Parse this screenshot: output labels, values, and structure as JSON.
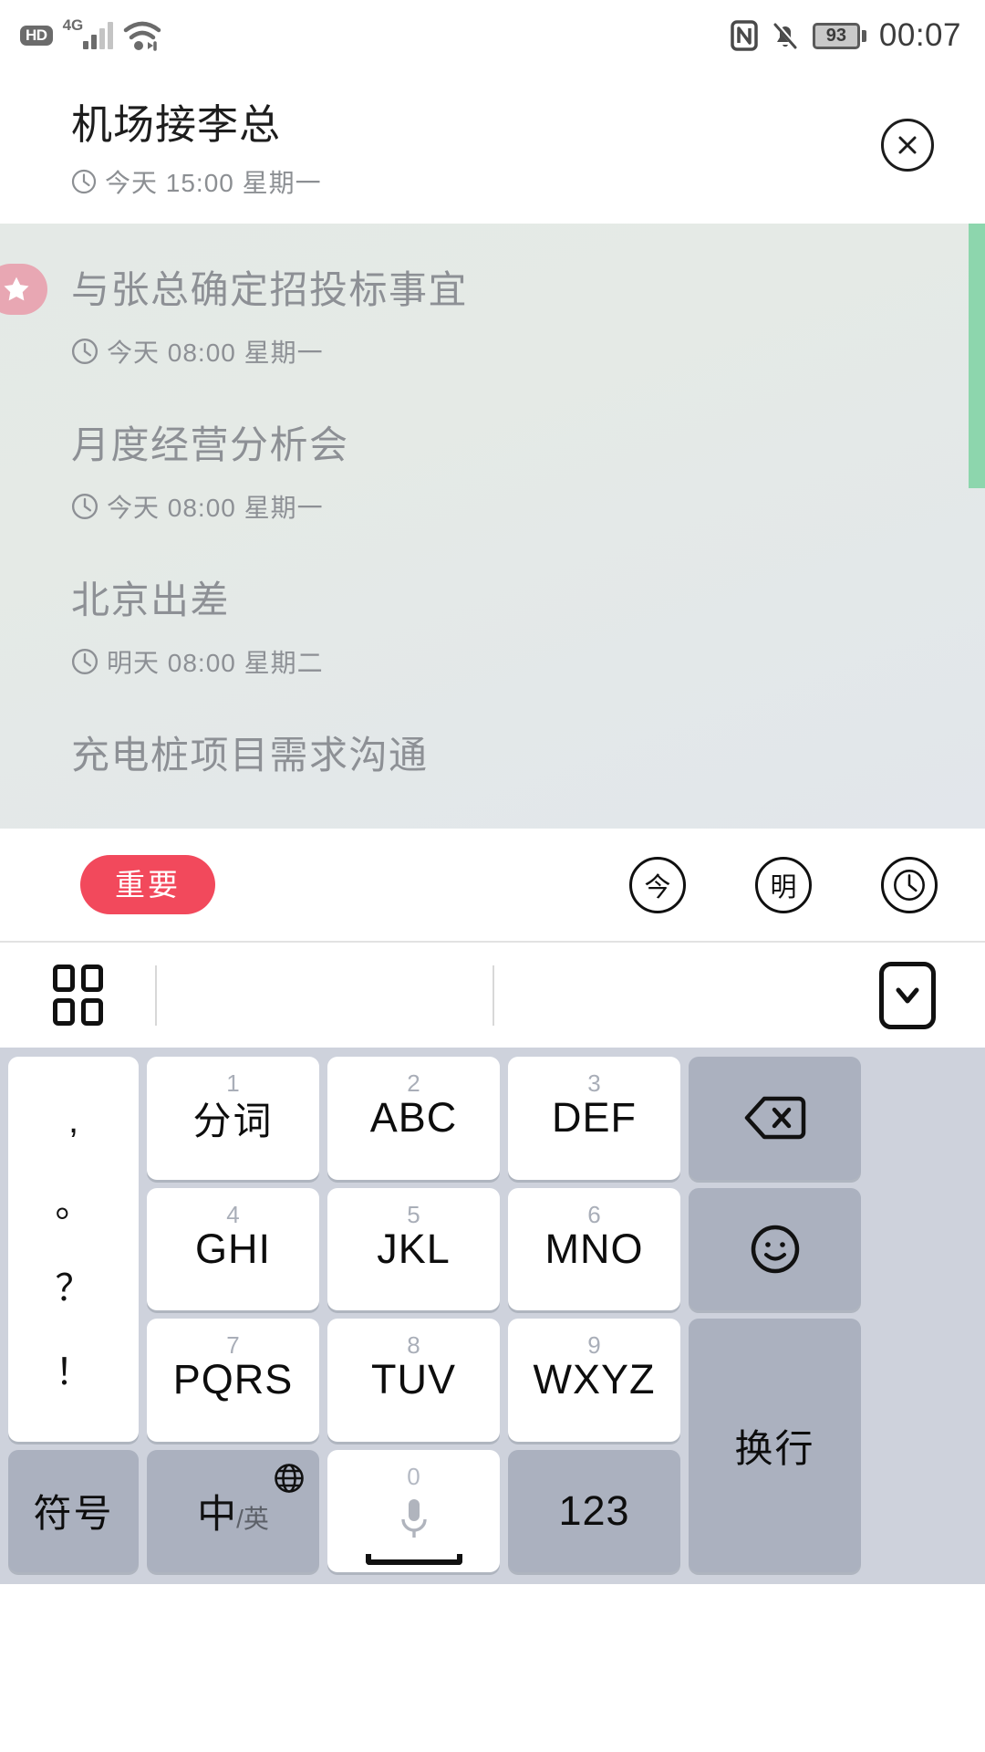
{
  "statusbar": {
    "hd_label": "HD",
    "network_label": "4G",
    "signal_icon": "signal-bars-icon",
    "wifi_icon": "wifi-icon",
    "nfc_icon": "nfc-icon",
    "mute_icon": "bell-muted-icon",
    "battery_level": "93",
    "time": "00:07"
  },
  "header": {
    "title": "机场接李总",
    "clock_icon": "clock-icon",
    "datetime": "今天 15:00 星期一",
    "close_icon": "close-circle-icon"
  },
  "tasks": [
    {
      "title": "与张总确定招投标事宜",
      "datetime": "今天 08:00 星期一",
      "starred": true,
      "star_icon": "star-icon",
      "clock_icon": "clock-icon"
    },
    {
      "title": "月度经营分析会",
      "datetime": "今天 08:00 星期一",
      "starred": false,
      "clock_icon": "clock-icon"
    },
    {
      "title": "北京出差",
      "datetime": "明天 08:00 星期二",
      "starred": false,
      "clock_icon": "clock-icon"
    },
    {
      "title": "充电桩项目需求沟通",
      "datetime": "",
      "starred": false,
      "clock_icon": "clock-icon"
    }
  ],
  "colors": {
    "important_pill": "#f2495c",
    "star_badge": "#e8a7b3",
    "green_strip": "#8dd6ad",
    "keyboard_bg": "#ced2dc",
    "key_gray": "#abb1bf"
  },
  "actionbar": {
    "important_label": "重要",
    "today_label": "今",
    "tomorrow_label": "明",
    "clock_icon": "clock-icon"
  },
  "keyboard_toolbar": {
    "grid_icon": "grid-apps-icon",
    "hide_icon": "chevron-down-icon"
  },
  "keyboard": {
    "punctuation": [
      ",",
      "。",
      "？",
      "！"
    ],
    "rows": [
      {
        "keys": [
          {
            "num": "1",
            "main": "分词",
            "style": "white",
            "icon": ""
          },
          {
            "num": "2",
            "main": "ABC",
            "style": "white",
            "icon": ""
          },
          {
            "num": "3",
            "main": "DEF",
            "style": "white",
            "icon": ""
          },
          {
            "num": "",
            "main": "",
            "style": "gray",
            "icon": "backspace-icon"
          }
        ]
      },
      {
        "keys": [
          {
            "num": "4",
            "main": "GHI",
            "style": "white",
            "icon": ""
          },
          {
            "num": "5",
            "main": "JKL",
            "style": "white",
            "icon": ""
          },
          {
            "num": "6",
            "main": "MNO",
            "style": "white",
            "icon": ""
          },
          {
            "num": "",
            "main": "",
            "style": "gray",
            "icon": "emoji-icon"
          }
        ]
      },
      {
        "keys": [
          {
            "num": "7",
            "main": "PQRS",
            "style": "white",
            "icon": ""
          },
          {
            "num": "8",
            "main": "TUV",
            "style": "white",
            "icon": ""
          },
          {
            "num": "9",
            "main": "WXYZ",
            "style": "white",
            "icon": ""
          },
          {
            "num": "",
            "main": "换行",
            "style": "gray",
            "icon": ""
          }
        ]
      },
      {
        "keys": [
          {
            "num": "",
            "main": "符号",
            "style": "gray",
            "icon": ""
          },
          {
            "num": "",
            "main": "中/英",
            "style": "gray",
            "icon": "globe-icon"
          },
          {
            "num": "0",
            "main": "",
            "style": "white",
            "icon": "microphone-icon"
          },
          {
            "num": "",
            "main": "123",
            "style": "gray",
            "icon": ""
          }
        ]
      }
    ],
    "symbol_label": "符号",
    "lang_cn": "中",
    "lang_en": "/英",
    "space_num": "0",
    "num_label": "123",
    "enter_label": "换行"
  }
}
